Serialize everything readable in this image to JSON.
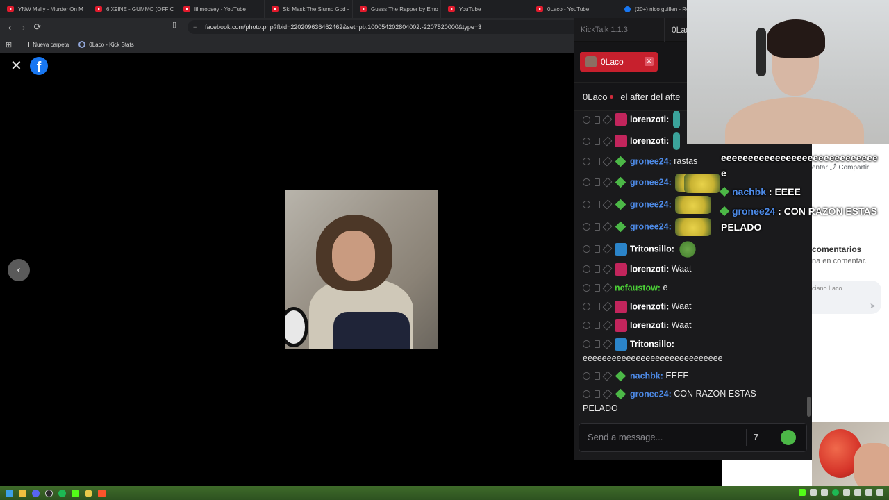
{
  "browser": {
    "tabs": [
      {
        "title": "YNW Melly - Murder On M",
        "icon": "youtube-icon"
      },
      {
        "title": "6IX9INE - GUMMO (OFFIC",
        "icon": "youtube-icon"
      },
      {
        "title": "lil moosey - YouTube",
        "icon": "youtube-icon"
      },
      {
        "title": "Ski Mask The Slump God -",
        "icon": "youtube-icon"
      },
      {
        "title": "Guess The Rapper by Emo",
        "icon": "youtube-icon"
      },
      {
        "title": "YouTube",
        "icon": "youtube-icon"
      },
      {
        "title": "0Laco - YouTube",
        "icon": "youtube-icon"
      },
      {
        "title": "(20+) nico guillen - Re",
        "icon": "facebook-icon"
      }
    ],
    "url": "facebook.com/photo.php?fbid=220209636462462&set=pb.100054202804002.-2207520000&type=3",
    "bookmarks": [
      {
        "label": "Nueva carpeta",
        "icon": "folder-icon"
      },
      {
        "label": "0Laco - Kick Stats",
        "icon": "kick-stats-icon"
      }
    ]
  },
  "facebook": {
    "logo_letter": "f",
    "share_text": "entar  ⤴ Compartir",
    "comments_title": "comentarios",
    "comments_sub": "na en comentar.",
    "comment_placeholder": "ciano Laco"
  },
  "kicktalk": {
    "app_title": "KickTalk 1.1.3",
    "channel_tab": "0Lac",
    "user_chip": "0Laco",
    "channel_name": "0Laco",
    "stream_title": "el after del afte",
    "input_placeholder": "Send a message...",
    "messages": [
      {
        "user": "lorenzoti:",
        "badge": "sub7",
        "text": "",
        "emote": "teal"
      },
      {
        "user": "lorenzoti:",
        "badge": "sub7",
        "text": "",
        "emote": "teal"
      },
      {
        "user": "gronee24:",
        "badge": "gem",
        "text": "rastas",
        "emote": ""
      },
      {
        "user": "gronee24:",
        "badge": "gem",
        "text": "",
        "emote": "minion"
      },
      {
        "user": "gronee24:",
        "badge": "gem",
        "text": "",
        "emote": "minion"
      },
      {
        "user": "gronee24:",
        "badge": "gem",
        "text": "",
        "emote": "minion"
      },
      {
        "user": "Tritonsillo:",
        "badge": "tri",
        "text": "",
        "emote": "pepe"
      },
      {
        "user": "lorenzoti:",
        "badge": "sub7",
        "text": "Waat",
        "emote": ""
      },
      {
        "user": "nefaustow:",
        "badge": "",
        "text": "e",
        "emote": ""
      },
      {
        "user": "lorenzoti:",
        "badge": "sub7",
        "text": "Waat",
        "emote": ""
      },
      {
        "user": "lorenzoti:",
        "badge": "sub7",
        "text": "Waat",
        "emote": ""
      },
      {
        "user": "Tritonsillo:",
        "badge": "tri",
        "text": "eeeeeeeeeeeeeeeeeeeeeeeeeeeee",
        "emote": ""
      },
      {
        "user": "nachbk:",
        "badge": "gem",
        "text": "EEEE",
        "emote": ""
      },
      {
        "user": "gronee24:",
        "badge": "gem",
        "text": "CON RAZON ESTAS PELADO",
        "emote": ""
      }
    ]
  },
  "overlay_chat": {
    "line1": "eeeeeeeeeeeeeeeeeeeeeeeeeeeee",
    "line1b": "e",
    "nachbk_user": "nachbk",
    "nachbk_text": ": EEEE",
    "gronee_user": "gronee24",
    "gronee_text": ": CON RAZON ESTAS",
    "gronee_text2": "PELADO"
  }
}
